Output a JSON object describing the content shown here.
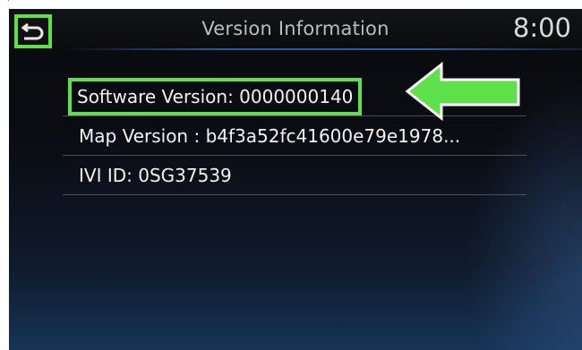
{
  "header": {
    "title": "Version Information",
    "clock": "8:00",
    "back_icon": "back-arrow-icon"
  },
  "rows": [
    {
      "label": "Software Version: 0000000140"
    },
    {
      "label": "Map Version : b4f3a52fc41600e79e1978..."
    },
    {
      "label": "IVI ID: 0SG37539"
    }
  ],
  "colors": {
    "highlight": "#5ee04a",
    "accent_line": "#2c5fa0"
  }
}
